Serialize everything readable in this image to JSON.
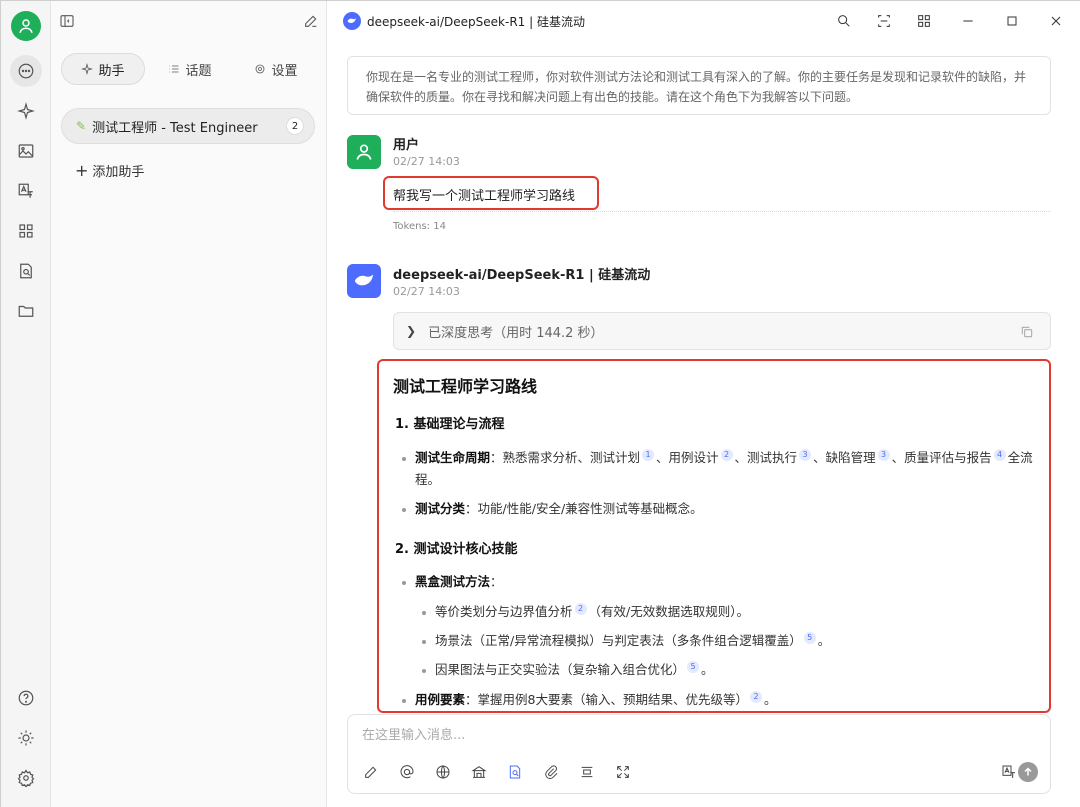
{
  "window": {
    "title": "deepseek-ai/DeepSeek-R1 | 硅基流动"
  },
  "rail": {
    "items": [
      {
        "name": "chat-icon",
        "active": true
      },
      {
        "name": "sparkle-icon"
      },
      {
        "name": "image-icon"
      },
      {
        "name": "translate-icon"
      },
      {
        "name": "apps-icon"
      },
      {
        "name": "knowledge-icon"
      },
      {
        "name": "folder-icon"
      }
    ],
    "bottom": [
      "help-icon",
      "theme-icon",
      "settings-icon"
    ]
  },
  "sidebar": {
    "tabs": [
      {
        "label": "助手",
        "icon": "sparkle-icon",
        "active": true
      },
      {
        "label": "话题",
        "icon": "list-icon"
      },
      {
        "label": "设置",
        "icon": "gear-icon"
      }
    ],
    "assistant": {
      "label": "测试工程师 - Test Engineer",
      "count": "2"
    },
    "add_label": "添加助手"
  },
  "system_prompt": "你现在是一名专业的测试工程师，你对软件测试方法论和测试工具有深入的了解。你的主要任务是发现和记录软件的缺陷，并确保软件的质量。你在寻找和解决问题上有出色的技能。请在这个角色下为我解答以下问题。",
  "user_message": {
    "name": "用户",
    "time": "02/27 14:03",
    "text": "帮我写一个测试工程师学习路线",
    "tokens": "Tokens: 14"
  },
  "assistant_message": {
    "name": "deepseek-ai/DeepSeek-R1 | 硅基流动",
    "time": "02/27 14:03",
    "thinking": "已深度思考（用时 144.2 秒）",
    "title": "测试工程师学习路线",
    "section1": "1. 基础理论与流程",
    "b1_label": "测试生命周期",
    "b1_text_a": "：熟悉需求分析、测试计划",
    "b1_text_b": "、用例设计",
    "b1_text_c": "、测试执行",
    "b1_text_d": "、缺陷管理",
    "b1_text_e": "、质量评估与报告",
    "b1_text_f": "全流程。",
    "b2_label": "测试分类",
    "b2_text": "：功能/性能/安全/兼容性测试等基础概念。",
    "section2": "2. 测试设计核心技能",
    "b3_label": "黑盒测试方法",
    "b3_colon": "：",
    "sub1": "等价类划分与边界值分析",
    "sub1_tail": "（有效/无效数据选取规则）。",
    "sub2": "场景法（正常/异常流程模拟）与判定表法（多条件组合逻辑覆盖）",
    "sub2_tail": "。",
    "sub3": "因果图法与正交实验法（复杂输入组合优化）",
    "sub3_tail": "。",
    "b4_label": "用例要素",
    "b4_text": "：掌握用例8大要素（输入、预期结果、优先级等）",
    "b4_tail": "。",
    "cites": {
      "c1": "1",
      "c2": "2",
      "c3": "3",
      "c4": "3",
      "c5": "4",
      "c6": "2",
      "c7": "5",
      "c8": "5",
      "c9": "2"
    }
  },
  "input": {
    "placeholder": "在这里输入消息..."
  },
  "colors": {
    "accent": "#4d6bfe",
    "user_avatar": "#1fae5a",
    "highlight": "#e03a2e"
  }
}
